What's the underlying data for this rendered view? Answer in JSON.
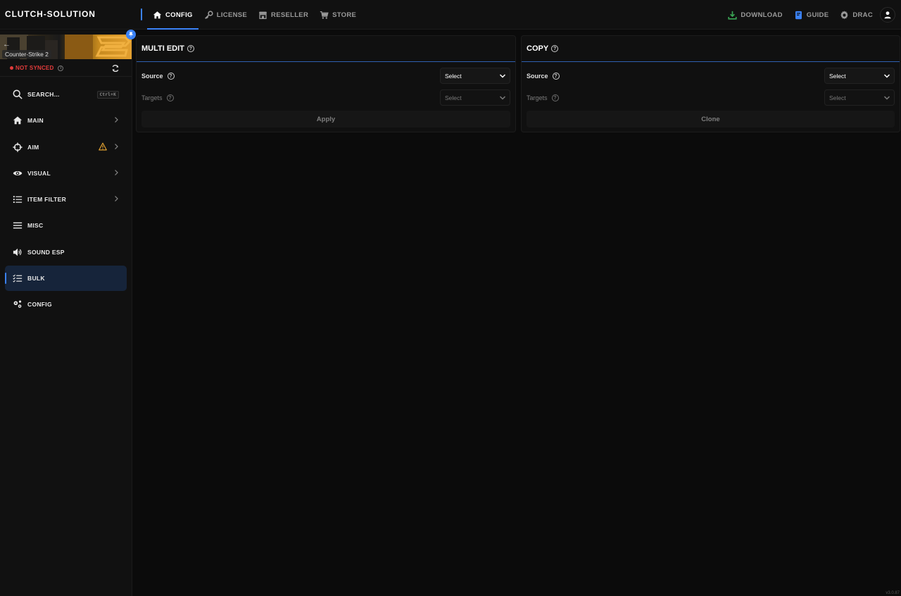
{
  "app": {
    "brand": "CLUTCH-SOLUTION",
    "version": "v3.0.87"
  },
  "nav": {
    "items": [
      {
        "label": "CONFIG",
        "icon": "home-icon",
        "active": true
      },
      {
        "label": "LICENSE",
        "icon": "key-icon",
        "active": false
      },
      {
        "label": "RESELLER",
        "icon": "store-icon",
        "active": false
      },
      {
        "label": "STORE",
        "icon": "cart-icon",
        "active": false
      }
    ],
    "right": {
      "download": "DOWNLOAD",
      "guide": "GUIDE",
      "user": "DRAC"
    }
  },
  "sidebar": {
    "game": "Counter-Strike 2",
    "sync_status": "NOT SYNCED",
    "items": [
      {
        "label": "SEARCH...",
        "icon": "search-icon",
        "shortcut": "Ctrl+K"
      },
      {
        "label": "MAIN",
        "icon": "home-icon"
      },
      {
        "label": "AIM",
        "icon": "crosshair-icon"
      },
      {
        "label": "VISUAL",
        "icon": "eye-icon"
      },
      {
        "label": "ITEM FILTER",
        "icon": "list-icon"
      },
      {
        "label": "MISC",
        "icon": "menu-icon"
      },
      {
        "label": "SOUND ESP",
        "icon": "speaker-icon"
      },
      {
        "label": "BULK",
        "icon": "checklist-icon",
        "active": true
      },
      {
        "label": "CONFIG",
        "icon": "gears-icon"
      }
    ]
  },
  "panels": {
    "multi_edit": {
      "title": "MULTI EDIT",
      "source_label": "Source",
      "source_value": "Select",
      "targets_label": "Targets",
      "targets_value": "Select",
      "action": "Apply"
    },
    "copy": {
      "title": "COPY",
      "source_label": "Source",
      "source_value": "Select",
      "targets_label": "Targets",
      "targets_value": "Select",
      "action": "Clone"
    }
  },
  "colors": {
    "accent": "#3b82f6",
    "warning": "#e0a030",
    "error": "#e23b3b",
    "download": "#3aa655"
  }
}
